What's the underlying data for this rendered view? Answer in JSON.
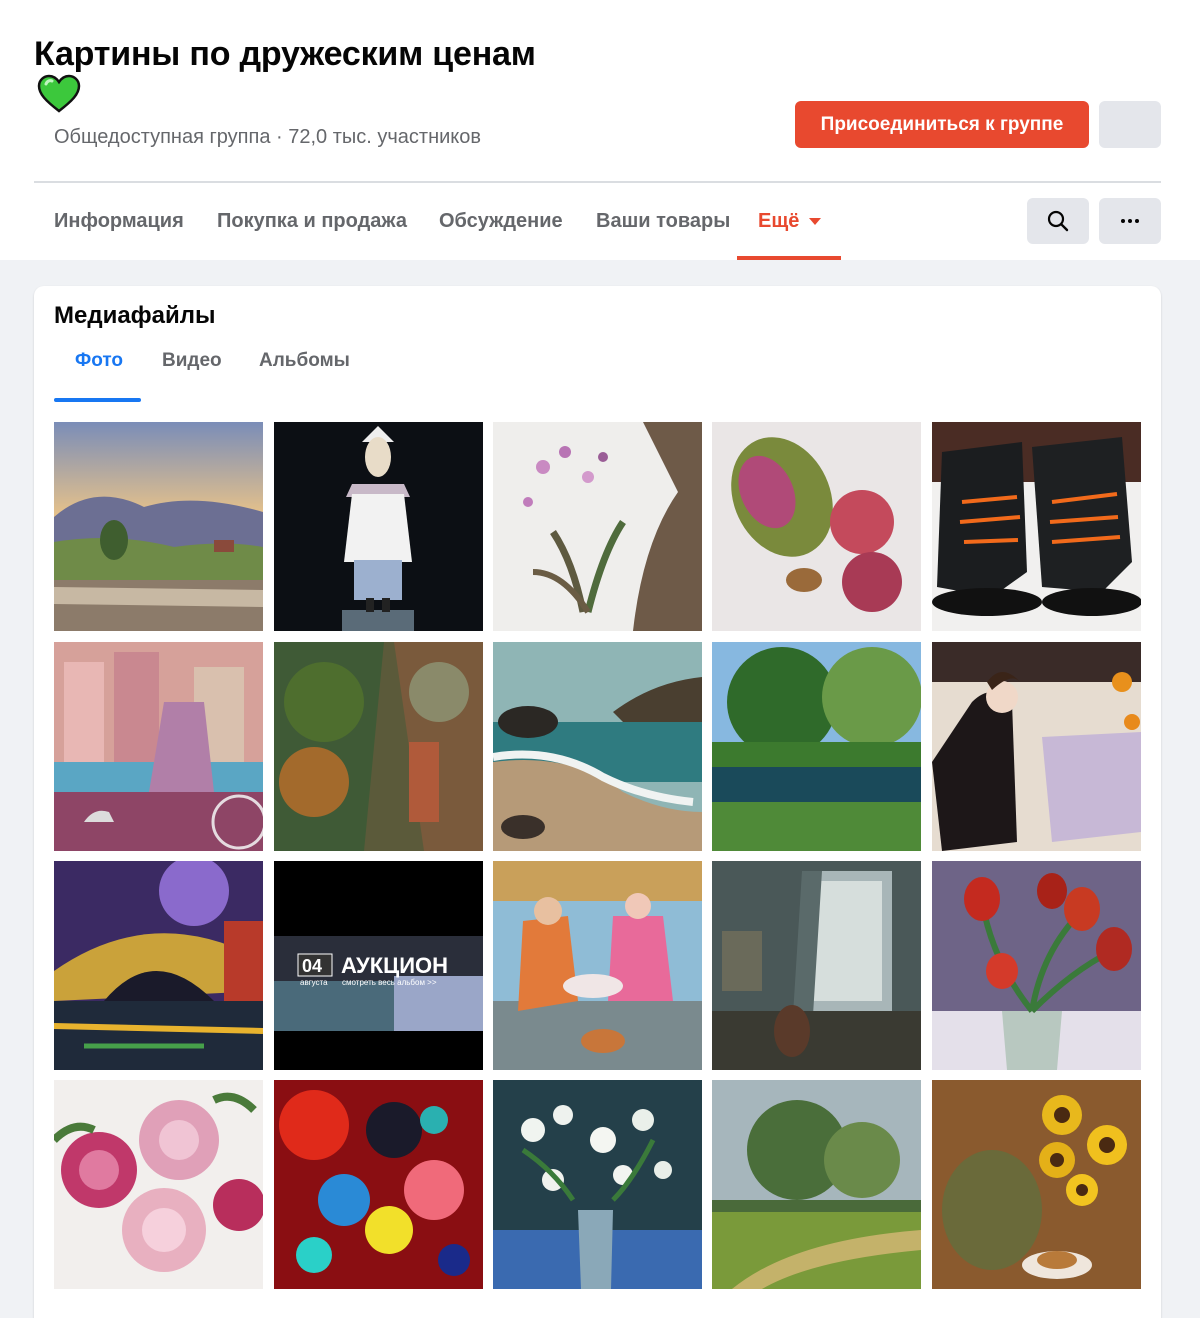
{
  "group": {
    "title": "Картины по дружеским ценам",
    "meta": "Общедоступная группа · 72,0 тыс. участников",
    "join_label": "Присоединиться к группе",
    "heart_color": "#3cc83c"
  },
  "nav": {
    "tabs": [
      {
        "label": "Информация"
      },
      {
        "label": "Покупка и продажа"
      },
      {
        "label": "Обсуждение"
      },
      {
        "label": "Ваши товары"
      },
      {
        "label": "Ещё"
      }
    ],
    "active_tab": "Ещё",
    "accent_color": "#e8492f"
  },
  "media": {
    "title": "Медиафайлы",
    "tabs": [
      {
        "label": "Фото"
      },
      {
        "label": "Видео"
      },
      {
        "label": "Альбомы"
      }
    ],
    "active_tab": "Фото",
    "auction_day": "04",
    "auction_month": "августа",
    "auction_word": "АУКЦИОН",
    "auction_sub": "смотреть весь альбом >>",
    "photos": [
      {
        "subject": "landscape-sunset"
      },
      {
        "subject": "pierrot-doll"
      },
      {
        "subject": "orchid-watercolor"
      },
      {
        "subject": "mango-peaches"
      },
      {
        "subject": "black-boots"
      },
      {
        "subject": "cyclist-city"
      },
      {
        "subject": "trees-alley"
      },
      {
        "subject": "sea-shore"
      },
      {
        "subject": "green-pond"
      },
      {
        "subject": "lady-at-table"
      },
      {
        "subject": "venice-bridge"
      },
      {
        "subject": "auction-banner"
      },
      {
        "subject": "cafe-couple"
      },
      {
        "subject": "interior-window"
      },
      {
        "subject": "red-tulips"
      },
      {
        "subject": "pink-peonies"
      },
      {
        "subject": "abstract-flowers"
      },
      {
        "subject": "white-flowers-vase"
      },
      {
        "subject": "summer-trees"
      },
      {
        "subject": "sunflowers-vase"
      }
    ]
  }
}
